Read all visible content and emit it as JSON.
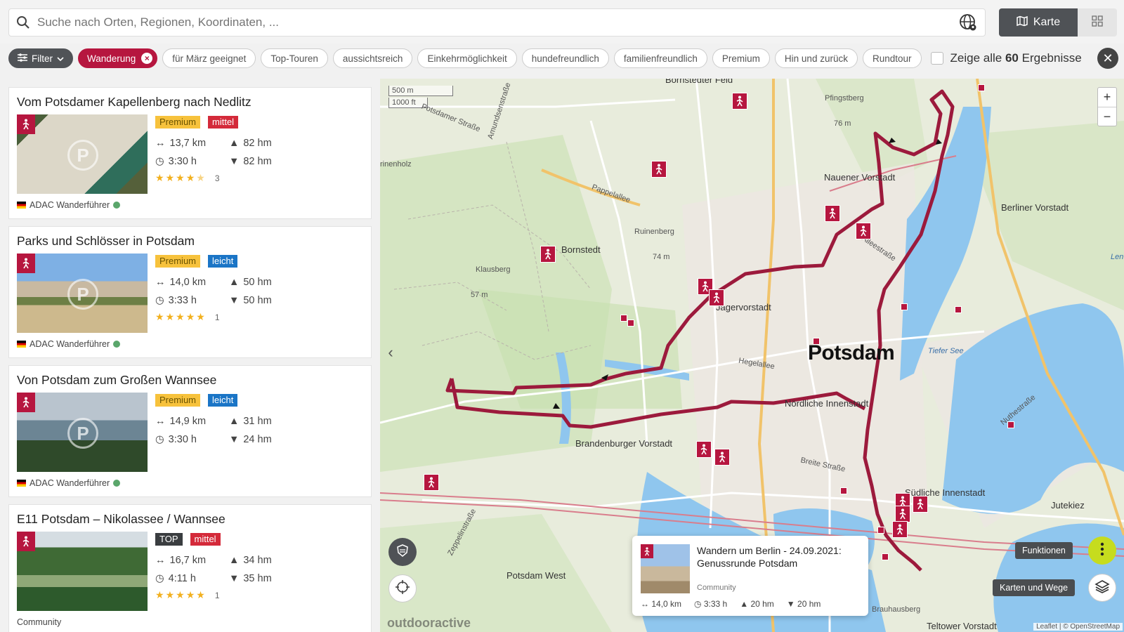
{
  "search": {
    "placeholder": "Suche nach Orten, Regionen, Koordinaten, ..."
  },
  "view": {
    "map_label": "Karte"
  },
  "filters": {
    "filter_label": "Filter",
    "active": "Wanderung",
    "chips": [
      "für März geeignet",
      "Top-Touren",
      "aussichtsreich",
      "Einkehrmöglichkeit",
      "hundefreundlich",
      "familienfreundlich",
      "Premium",
      "Hin und zurück",
      "Rundtour"
    ],
    "show_all_prefix": "Zeige alle",
    "show_all_count": "60",
    "show_all_suffix": "Ergebnisse"
  },
  "tours": [
    {
      "title": "Vom Potsdamer Kapellenberg nach Nedlitz",
      "badges": [
        {
          "text": "Premium",
          "kind": "premium"
        },
        {
          "text": "mittel",
          "kind": "mittel"
        }
      ],
      "distance": "13,7 km",
      "duration": "3:30 h",
      "ascent": "82 hm",
      "descent": "82 hm",
      "rating": 4.5,
      "rating_count": "3",
      "source": "ADAC Wanderführer"
    },
    {
      "title": "Parks und Schlösser in Potsdam",
      "badges": [
        {
          "text": "Premium",
          "kind": "premium"
        },
        {
          "text": "leicht",
          "kind": "leicht"
        }
      ],
      "distance": "14,0 km",
      "duration": "3:33 h",
      "ascent": "50 hm",
      "descent": "50 hm",
      "rating": 5,
      "rating_count": "1",
      "source": "ADAC Wanderführer"
    },
    {
      "title": "Von Potsdam zum Großen Wannsee",
      "badges": [
        {
          "text": "Premium",
          "kind": "premium"
        },
        {
          "text": "leicht",
          "kind": "leicht"
        }
      ],
      "distance": "14,9 km",
      "duration": "3:30 h",
      "ascent": "31 hm",
      "descent": "24 hm",
      "rating": null,
      "rating_count": "",
      "source": "ADAC Wanderführer"
    },
    {
      "title": "E11 Potsdam – Nikolassee / Wannsee",
      "badges": [
        {
          "text": "TOP",
          "kind": "top"
        },
        {
          "text": "mittel",
          "kind": "mittel"
        }
      ],
      "distance": "16,7 km",
      "duration": "4:11 h",
      "ascent": "34 hm",
      "descent": "35 hm",
      "rating": 5,
      "rating_count": "1",
      "source": "Community"
    }
  ],
  "map": {
    "scale_m": "500 m",
    "scale_ft": "1000 ft",
    "zoom_in": "+",
    "zoom_out": "−",
    "city": "Potsdam",
    "labels": {
      "bornstedter_feld": "Bornstedter Feld",
      "pfingstberg": "Pfingstberg",
      "nauener_vorstadt": "Nauener Vorstadt",
      "berliner_vorstadt": "Berliner Vorstadt",
      "bornstedt": "Bornstedt",
      "ruinenberg": "Ruinenberg",
      "klausberg": "Klausberg",
      "jaegervorstadt": "Jägervorstadt",
      "noerdliche_innenstadt": "Nördliche Innenstadt",
      "brandenburger_vorstadt": "Brandenburger Vorstadt",
      "suedliche_innenstadt": "Südliche Innenstadt",
      "jutekiez": "Jutekiez",
      "potsdam_west": "Potsdam West",
      "brauhausberg": "Brauhausberg",
      "teltower_vorstadt": "Teltower Vorstadt",
      "pappelallee": "Pappelallee",
      "potsdamer_strasse": "Potsdamer Straße",
      "amundsenstrasse": "Amundsenstraße",
      "hegelallee": "Hegelallee",
      "breite_strasse": "Breite Straße",
      "alleestrasse": "Alleestraße",
      "zeppelinstrasse": "Zeppelinstraße",
      "tiefer_see": "Tiefer See",
      "nuthestrasse": "Nuthestraße",
      "len": "Len",
      "rinenholz": "rinenholz",
      "h76": "76 m",
      "h74": "74 m",
      "h57": "57 m"
    },
    "popup": {
      "title": "Wandern um Berlin - 24.09.2021: Genussrunde Potsdam",
      "category": "Community",
      "distance": "14,0 km",
      "duration": "3:33 h",
      "ascent": "20 hm",
      "descent": "20 hm"
    },
    "functions_label": "Funktionen",
    "layers_label": "Karten und Wege",
    "attribution": "Leaflet | © OpenStreetMap",
    "watermark": "outdooractive"
  },
  "colors": {
    "accent": "#b6163f",
    "premium": "#f7c23c",
    "leicht": "#1b75c6",
    "mittel": "#d42a3a",
    "fab": "#c6dc1e"
  }
}
